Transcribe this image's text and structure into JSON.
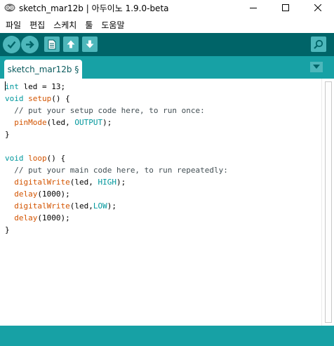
{
  "window": {
    "title": "sketch_mar12b | 아두이노 1.9.0-beta",
    "app_icon": "arduino-logo-icon",
    "controls": [
      "minimize-icon",
      "maximize-icon",
      "close-icon"
    ]
  },
  "menu": {
    "items": [
      {
        "label": "파일"
      },
      {
        "label": "편집"
      },
      {
        "label": "스케치"
      },
      {
        "label": "툴"
      },
      {
        "label": "도움말"
      }
    ]
  },
  "toolbar": {
    "buttons": [
      {
        "name": "verify-button",
        "icon": "checkmark-icon"
      },
      {
        "name": "upload-button",
        "icon": "arrow-right-icon"
      },
      {
        "name": "new-button",
        "icon": "document-icon"
      },
      {
        "name": "open-button",
        "icon": "arrow-up-icon"
      },
      {
        "name": "save-button",
        "icon": "arrow-down-icon"
      },
      {
        "name": "serial-monitor-button",
        "icon": "magnifier-icon"
      }
    ],
    "background": "#006468",
    "button_color": "#4db7bb"
  },
  "tabs": {
    "active_tab": "sketch_mar12b §",
    "menu_icon": "triangle-down-icon"
  },
  "editor": {
    "lines": [
      [
        {
          "t": "int",
          "c": "kw-type"
        },
        {
          "t": " led = 13;"
        }
      ],
      [
        {
          "t": "void",
          "c": "kw-type"
        },
        {
          "t": " "
        },
        {
          "t": "setup",
          "c": "kw-fn"
        },
        {
          "t": "() {"
        }
      ],
      [
        {
          "t": "  "
        },
        {
          "t": "// put your setup code here, to run once:",
          "c": "cmt"
        }
      ],
      [
        {
          "t": "  "
        },
        {
          "t": "pinMode",
          "c": "kw-fn"
        },
        {
          "t": "(led, "
        },
        {
          "t": "OUTPUT",
          "c": "kw-const"
        },
        {
          "t": ");"
        }
      ],
      [
        {
          "t": "}"
        }
      ],
      [],
      [
        {
          "t": "void",
          "c": "kw-type"
        },
        {
          "t": " "
        },
        {
          "t": "loop",
          "c": "kw-fn"
        },
        {
          "t": "() {"
        }
      ],
      [
        {
          "t": "  "
        },
        {
          "t": "// put your main code here, to run repeatedly:",
          "c": "cmt"
        }
      ],
      [
        {
          "t": "  "
        },
        {
          "t": "digitalWrite",
          "c": "kw-fn"
        },
        {
          "t": "(led, "
        },
        {
          "t": "HIGH",
          "c": "kw-const"
        },
        {
          "t": ");"
        }
      ],
      [
        {
          "t": "  "
        },
        {
          "t": "delay",
          "c": "kw-fn"
        },
        {
          "t": "(1000);"
        }
      ],
      [
        {
          "t": "  "
        },
        {
          "t": "digitalWrite",
          "c": "kw-fn"
        },
        {
          "t": "(led,"
        },
        {
          "t": "LOW",
          "c": "kw-const"
        },
        {
          "t": ");"
        }
      ],
      [
        {
          "t": "  "
        },
        {
          "t": "delay",
          "c": "kw-fn"
        },
        {
          "t": "(1000);"
        }
      ],
      [
        {
          "t": "}"
        }
      ]
    ],
    "colors": {
      "keyword": "#00979c",
      "function": "#d35400",
      "comment": "#434f54"
    }
  },
  "theme": {
    "tab_strip": "#17a1a5",
    "status_bar": "#17a1a5"
  }
}
